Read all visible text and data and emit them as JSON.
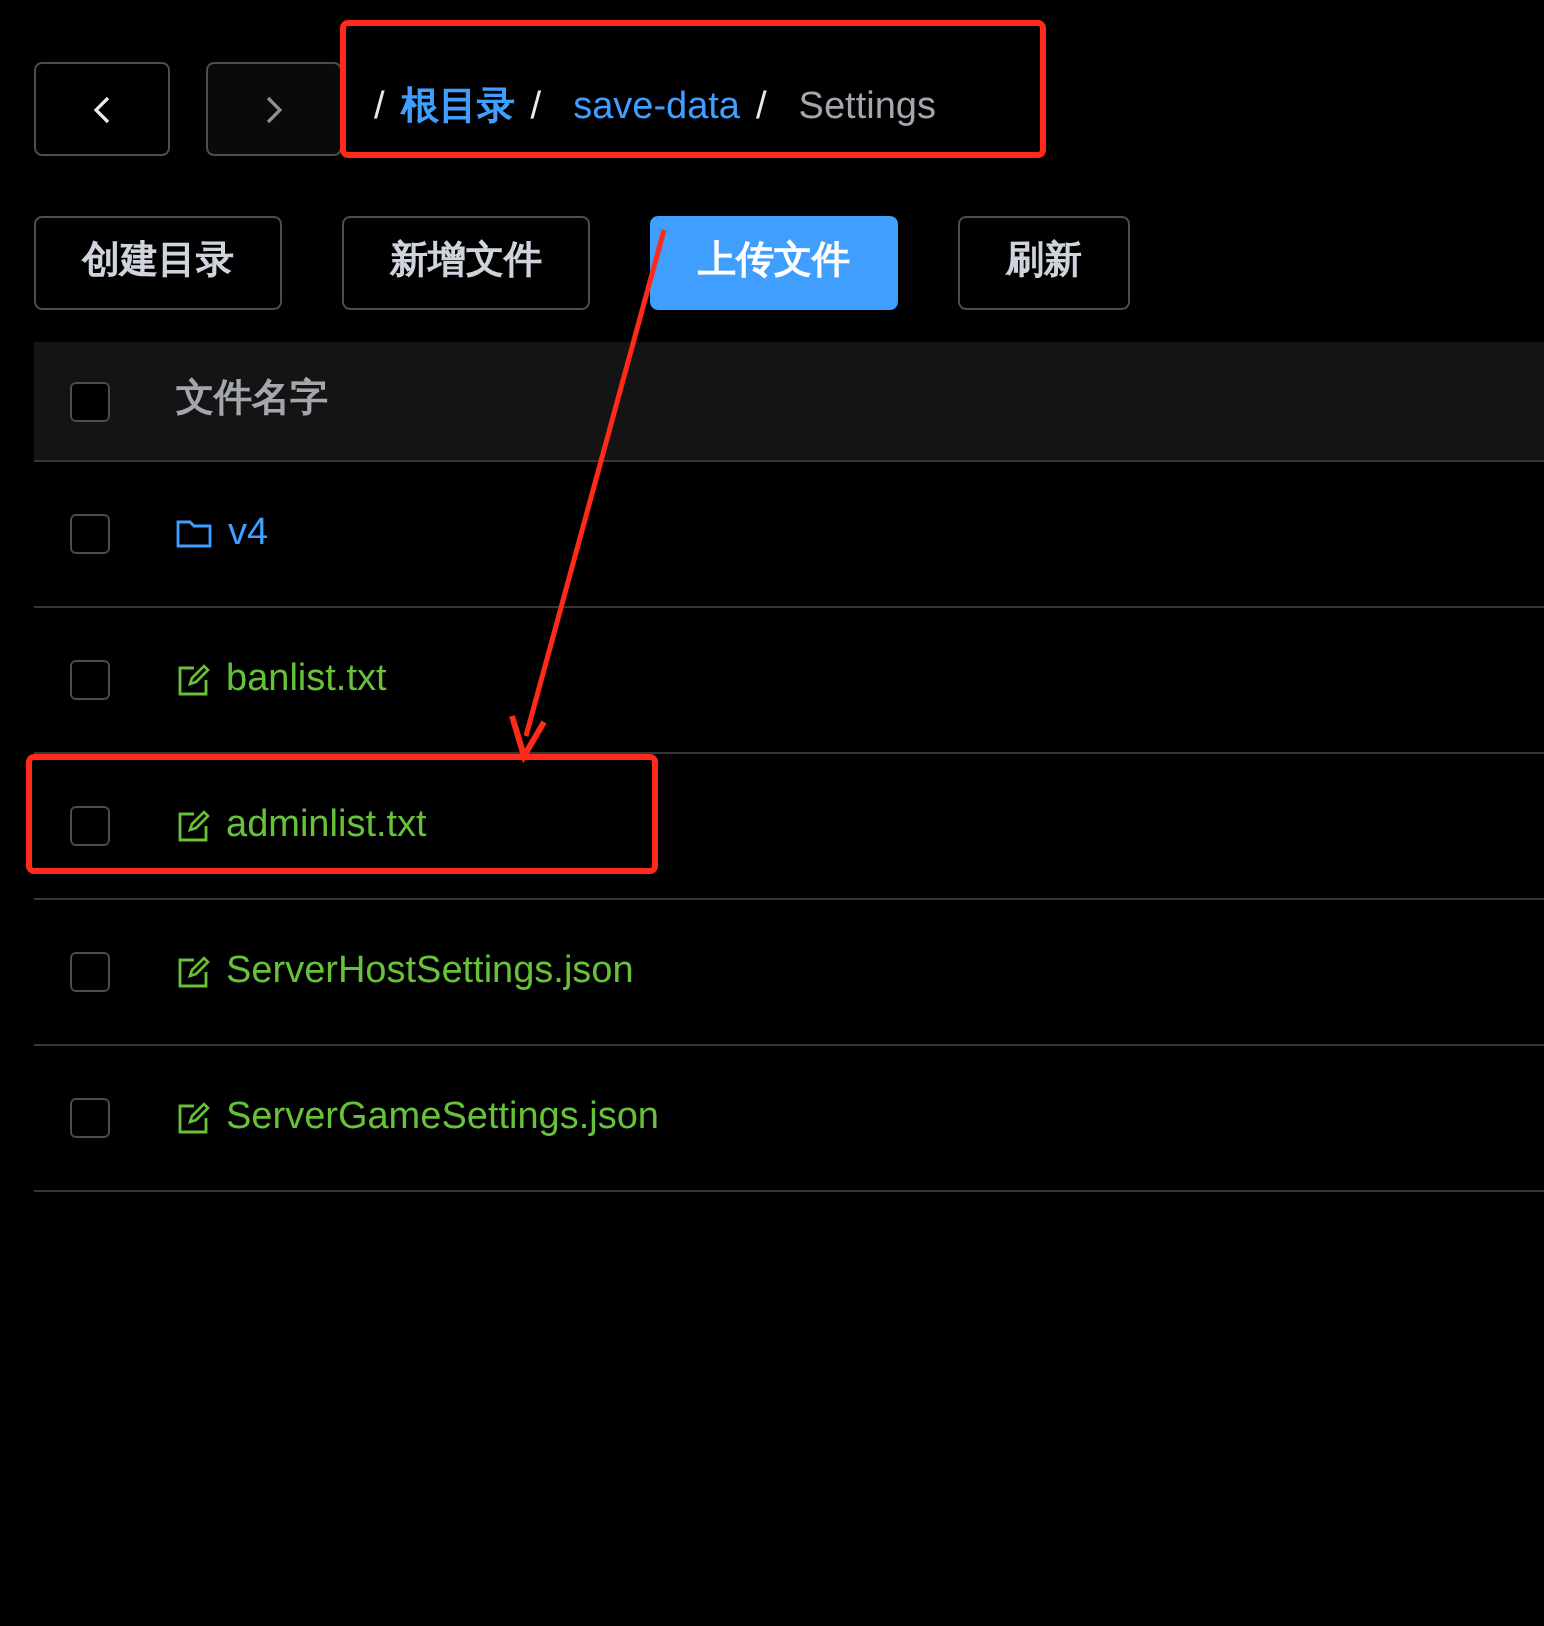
{
  "nav": [
    {
      "kind": "back",
      "disabled": false
    },
    {
      "kind": "forward",
      "disabled": true
    }
  ],
  "breadcrumb": [
    {
      "separator": "/",
      "label": "根目录",
      "kind": "root"
    },
    {
      "separator": "/",
      "label": "save-data",
      "kind": "link"
    },
    {
      "separator": "/",
      "label": "Settings",
      "kind": "current"
    }
  ],
  "toolbar": [
    {
      "label": "创建目录",
      "kind": "default"
    },
    {
      "label": "新增文件",
      "kind": "default"
    },
    {
      "label": "上传文件",
      "kind": "primary"
    },
    {
      "label": "刷新",
      "kind": "default"
    }
  ],
  "table": {
    "header": {
      "checked": false,
      "label": "文件名字"
    },
    "rows": [
      {
        "name": "v4",
        "kind": "folder",
        "checked": false
      },
      {
        "name": "banlist.txt",
        "kind": "file",
        "checked": false
      },
      {
        "name": "adminlist.txt",
        "kind": "file",
        "checked": false
      },
      {
        "name": "ServerHostSettings.json",
        "kind": "file",
        "checked": false
      },
      {
        "name": "ServerGameSettings.json",
        "kind": "file",
        "checked": false
      }
    ]
  }
}
